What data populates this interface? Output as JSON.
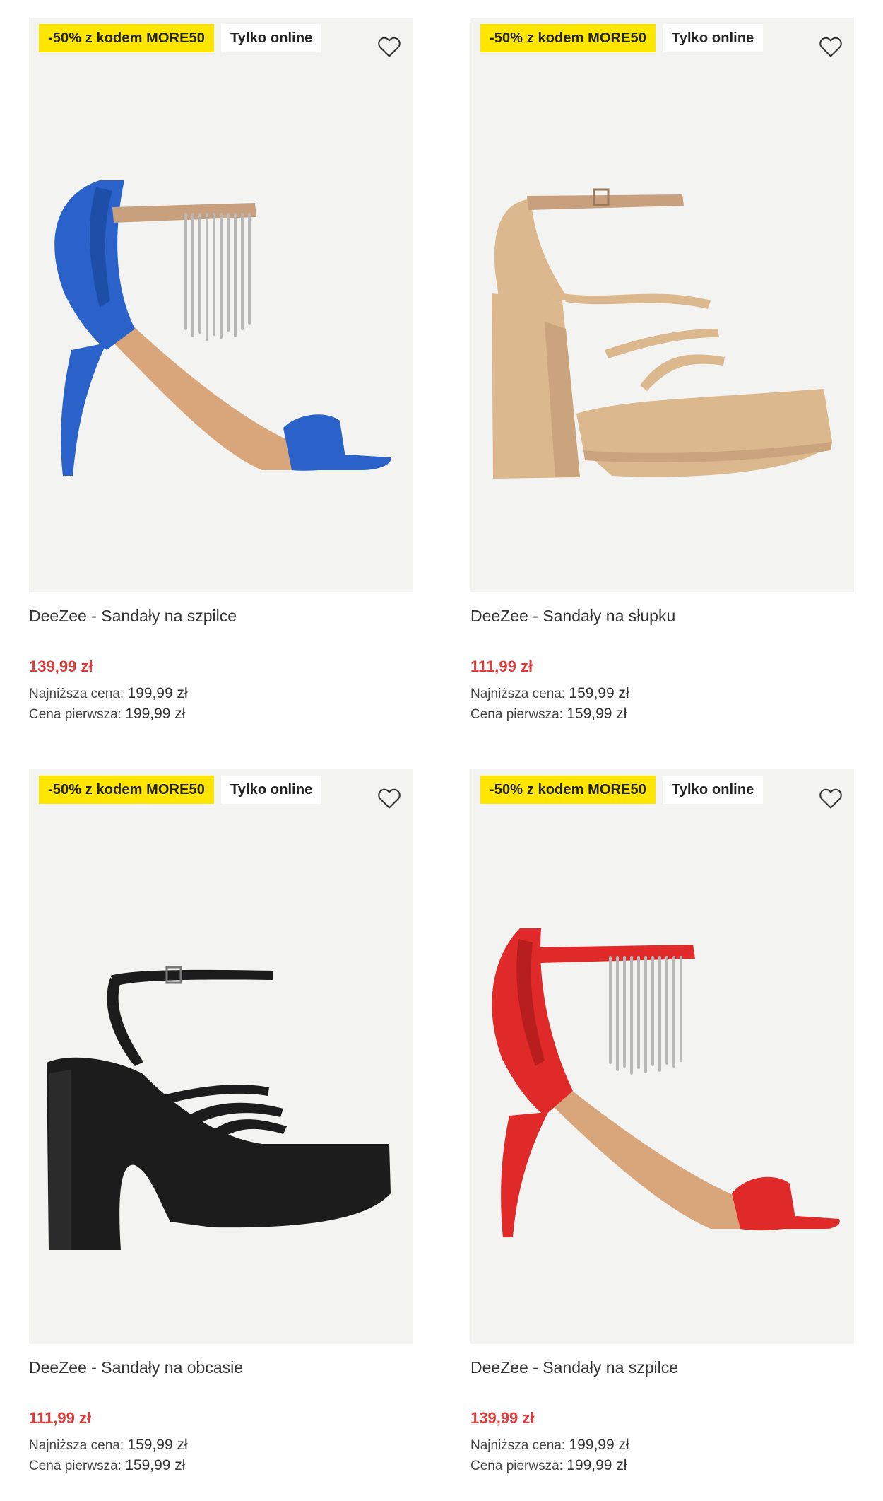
{
  "products": [
    {
      "promo_badge": "-50% z kodem MORE50",
      "online_badge": "Tylko online",
      "title": "DeeZee - Sandały na szpilce",
      "price": "139,99 zł",
      "lowest_label": "Najniższa cena:",
      "lowest_value": "199,99 zł",
      "first_label": "Cena pierwsza:",
      "first_value": "199,99 zł",
      "shoe_color": "#2a62c9"
    },
    {
      "promo_badge": "-50% z kodem MORE50",
      "online_badge": "Tylko online",
      "title": "DeeZee - Sandały na słupku",
      "price": "111,99 zł",
      "lowest_label": "Najniższa cena:",
      "lowest_value": "159,99 zł",
      "first_label": "Cena pierwsza:",
      "first_value": "159,99 zł",
      "shoe_color": "#dcb88f"
    },
    {
      "promo_badge": "-50% z kodem MORE50",
      "online_badge": "Tylko online",
      "title": "DeeZee - Sandały na obcasie",
      "price": "111,99 zł",
      "lowest_label": "Najniższa cena:",
      "lowest_value": "159,99 zł",
      "first_label": "Cena pierwsza:",
      "first_value": "159,99 zł",
      "shoe_color": "#1c1c1c"
    },
    {
      "promo_badge": "-50% z kodem MORE50",
      "online_badge": "Tylko online",
      "title": "DeeZee - Sandały na szpilce",
      "price": "139,99 zł",
      "lowest_label": "Najniższa cena:",
      "lowest_value": "199,99 zł",
      "first_label": "Cena pierwsza:",
      "first_value": "199,99 zł",
      "shoe_color": "#e02a2a"
    }
  ],
  "colors": {
    "promo_badge_bg": "#ffe600",
    "price_red": "#e03b3b",
    "image_bg": "#f3f4f2"
  },
  "icons": {
    "wishlist": "heart-outline-icon"
  }
}
